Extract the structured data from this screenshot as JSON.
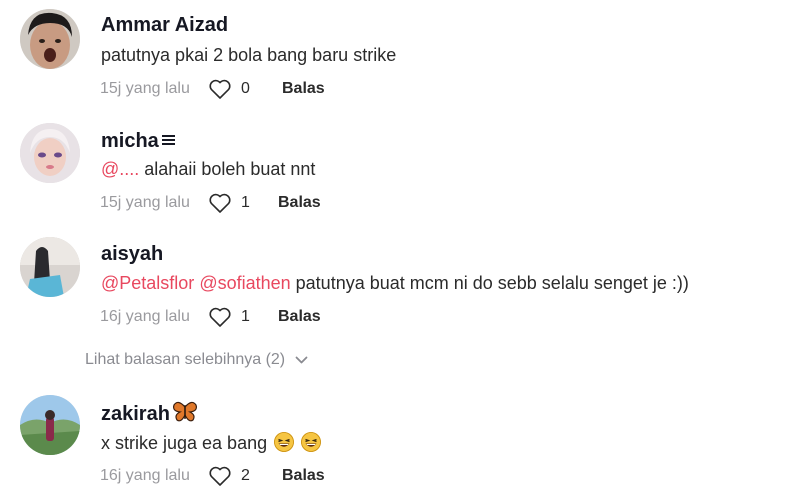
{
  "comments": [
    {
      "username": "Ammar Aizad",
      "text": "patutnya pkai 2 bola bang baru strike",
      "time": "15j yang lalu",
      "likes": "0",
      "reply_label": "Balas"
    },
    {
      "username": "micha",
      "mention": "@....",
      "text": " alahaii boleh buat nnt",
      "time": "15j yang lalu",
      "likes": "1",
      "reply_label": "Balas"
    },
    {
      "username": "aisyah",
      "mention1": "@Petalsflor",
      "mention2": "@sofiathen",
      "text": " patutnya buat mcm ni do sebb selalu senget je :))",
      "time": "16j yang lalu",
      "likes": "1",
      "reply_label": "Balas"
    },
    {
      "username": "zakirah",
      "text": "x strike juga ea bang",
      "time": "16j yang lalu",
      "likes": "2",
      "reply_label": "Balas"
    }
  ],
  "view_more_replies": "Lihat balasan selebihnya (2)",
  "colors": {
    "mention": "#e8485f",
    "muted": "#9a9a9e",
    "text": "#161823"
  }
}
